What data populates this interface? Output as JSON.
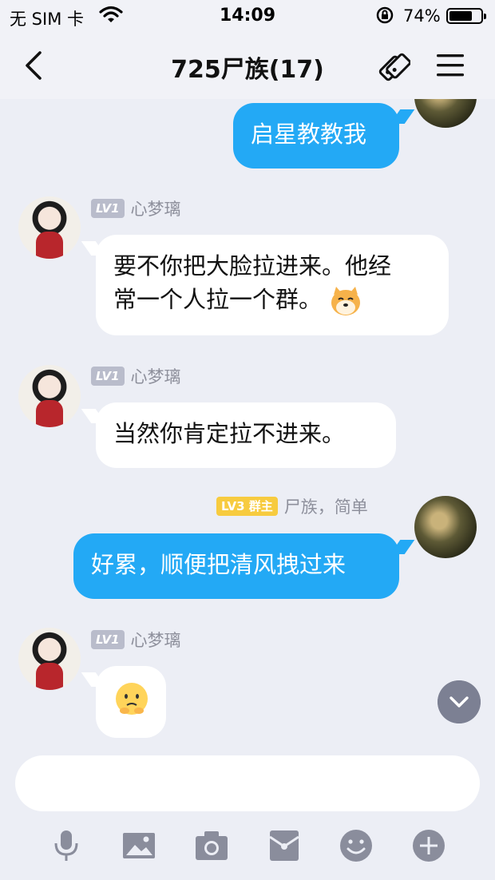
{
  "status_bar": {
    "carrier": "无 SIM 卡",
    "time": "14:09",
    "battery_percent": "74%",
    "battery_level": 0.74
  },
  "nav": {
    "title": "725尸族(17)"
  },
  "messages": [
    {
      "direction": "out",
      "text": "启星教教我"
    },
    {
      "direction": "in",
      "level": "LV1",
      "sender": "心梦璃",
      "text_line1": "要不你把大脸拉进来。他经",
      "text_line2": "常一个人拉一个群。",
      "emoji": "doge-icon"
    },
    {
      "direction": "in",
      "level": "LV1",
      "sender": "心梦璃",
      "text": "当然你肯定拉不进来。"
    },
    {
      "direction": "out",
      "level": "LV3",
      "role": "群主",
      "sender": "尸族，简单",
      "text": "好累，顺便把清风拽过来"
    },
    {
      "direction": "in",
      "level": "LV1",
      "sender": "心梦璃",
      "emoji": "face-emoji-icon"
    }
  ],
  "input": {
    "placeholder": ""
  },
  "colors": {
    "outgoing_bubble": "#23a9f5",
    "incoming_bubble": "#ffffff",
    "background": "#eceef5",
    "level_badge": "#b9bccb",
    "owner_badge": "#f7cb3f"
  },
  "toolbar": [
    "microphone-icon",
    "image-icon",
    "camera-icon",
    "red-packet-icon",
    "emoji-icon",
    "plus-icon"
  ]
}
